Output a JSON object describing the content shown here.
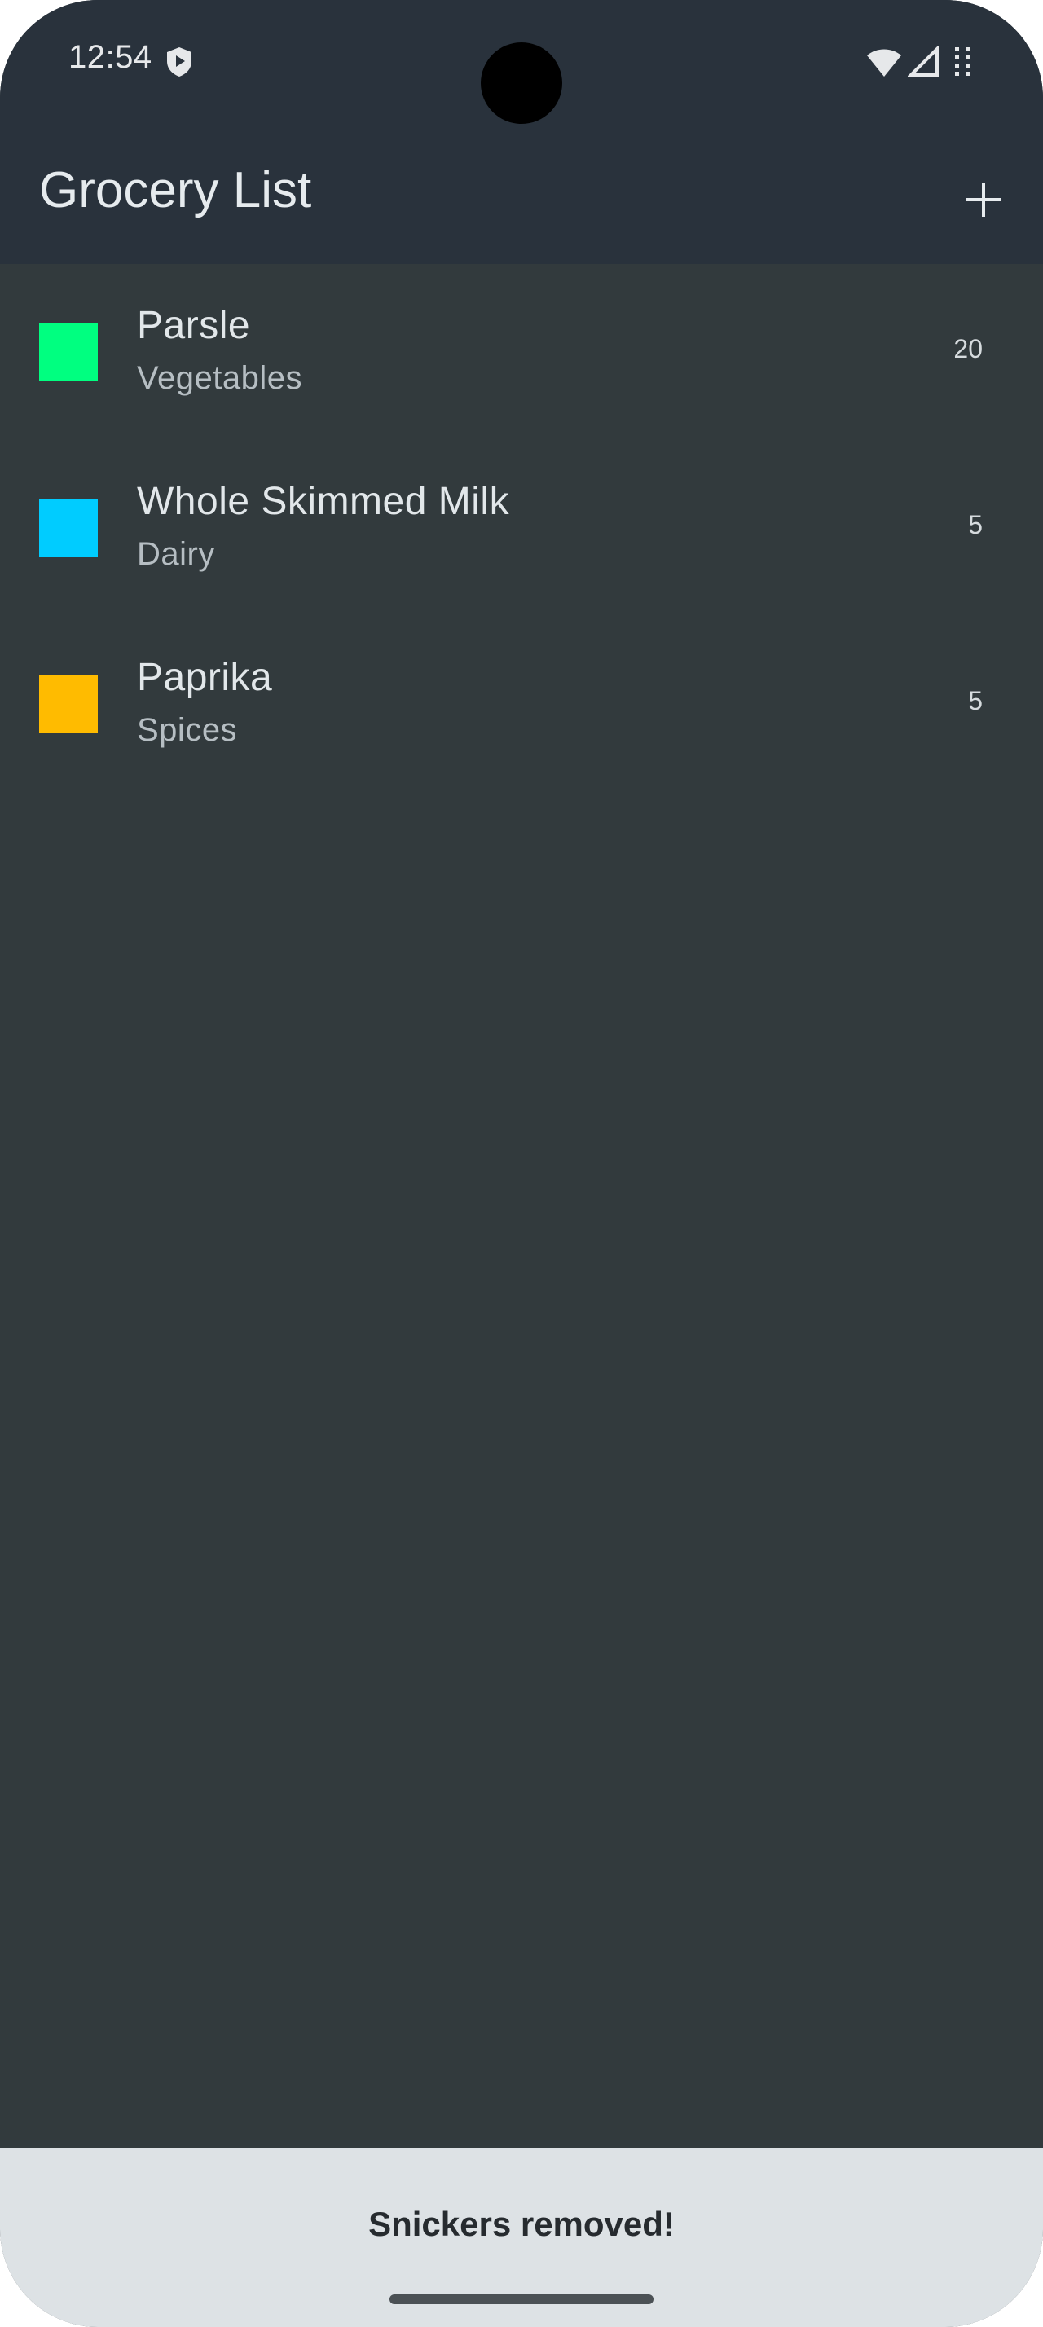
{
  "status_bar": {
    "time": "12:54",
    "icons": [
      "shield-icon",
      "wifi-icon",
      "cell-signal-icon",
      "battery-icon"
    ]
  },
  "app_bar": {
    "title": "Grocery List",
    "add_icon": "plus-icon"
  },
  "items": [
    {
      "name": "Parsle",
      "category": "Vegetables",
      "quantity": "20",
      "color": "#00ff80"
    },
    {
      "name": "Whole Skimmed Milk",
      "category": "Dairy",
      "quantity": "5",
      "color": "#00ccff"
    },
    {
      "name": "Paprika",
      "category": "Spices",
      "quantity": "5",
      "color": "#ffbb00"
    }
  ],
  "snackbar": {
    "message": "Snickers removed!"
  },
  "colors": {
    "background": "#323a3d",
    "app_bar": "#29323c",
    "snackbar": "#dde2e5"
  }
}
